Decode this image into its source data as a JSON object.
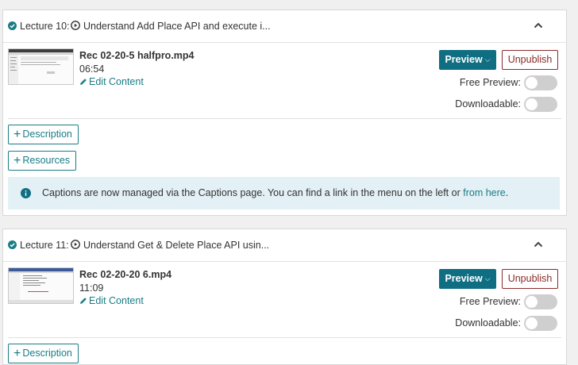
{
  "lectures": [
    {
      "label": "Lecture 10:",
      "title": "Understand Add Place API and execute i...",
      "file_name": "Rec 02-20-5 halfpro.mp4",
      "duration": "06:54",
      "edit_label": "Edit Content",
      "preview_label": "Preview",
      "unpublish_label": "Unpublish",
      "free_preview_label": "Free Preview:",
      "free_preview_on": false,
      "downloadable_label": "Downloadable:",
      "downloadable_on": false,
      "description_label": "Description",
      "resources_label": "Resources",
      "captions_text": "Captions are now managed via the Captions page. You can find a link in the menu on the left or",
      "captions_link": "from here",
      "captions_end": "."
    },
    {
      "label": "Lecture 11:",
      "title": "Understand Get & Delete Place API usin...",
      "file_name": "Rec 02-20-20 6.mp4",
      "duration": "11:09",
      "edit_label": "Edit Content",
      "preview_label": "Preview",
      "unpublish_label": "Unpublish",
      "free_preview_label": "Free Preview:",
      "free_preview_on": false,
      "downloadable_label": "Downloadable:",
      "downloadable_on": false,
      "description_label": "Description"
    }
  ],
  "colors": {
    "accent": "#0f6e82",
    "link": "#1a7c86",
    "danger": "#8b2b2b",
    "info_bg": "#e3f0f5"
  },
  "icons": [
    "check-circle-icon",
    "play-circle-icon",
    "chevron-up-icon",
    "pencil-icon",
    "plus-icon",
    "info-icon",
    "caret-down-icon"
  ]
}
